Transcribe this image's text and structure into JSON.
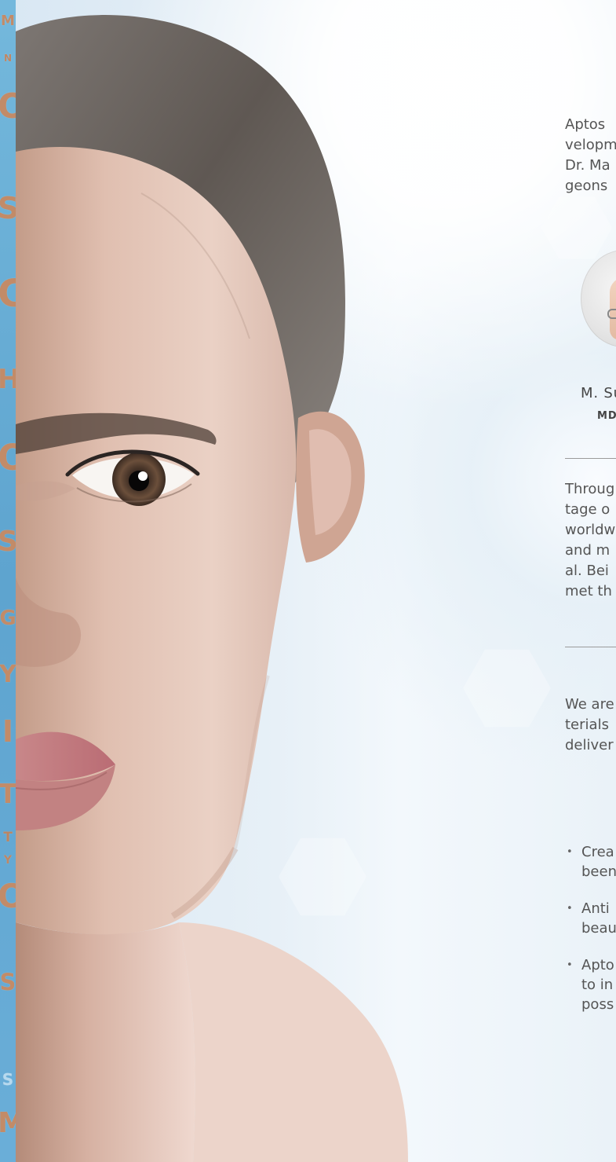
{
  "decorative_strip": {
    "glyphs": [
      "M",
      "N",
      "O",
      "S",
      "C",
      "H",
      "O",
      "S",
      "G",
      "Y",
      "I",
      "T",
      "T",
      "Y",
      "O",
      "S",
      "S",
      "M"
    ]
  },
  "right_panel": {
    "intro_lines": [
      "Aptos",
      "velopm",
      "Dr. Ma",
      "geons"
    ],
    "doctor": {
      "name": "M. Su",
      "credential": "MD"
    },
    "history_lines": [
      "Throug",
      "tage o",
      "worldw",
      "and m",
      "al. Bei",
      "met th"
    ],
    "values_lines": [
      "We are",
      "terials",
      "deliver"
    ],
    "bullets": [
      {
        "line1": "Crea",
        "line2": "been"
      },
      {
        "line1": "Anti",
        "line2": "beau"
      },
      {
        "line1": "Apto",
        "line2": "to in",
        "line3": "poss"
      }
    ]
  },
  "colors": {
    "strip": "#6aaed8",
    "strip_glyph": "#c28b68",
    "text": "#555555",
    "divider": "#9b9b9b"
  },
  "icons": {
    "avatar": "doctor-avatar-icon"
  }
}
